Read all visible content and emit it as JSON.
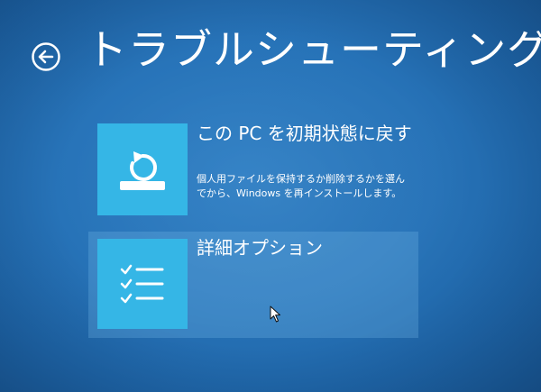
{
  "header": {
    "title": "トラブルシューティング",
    "back_icon": "back-arrow-circle-icon"
  },
  "options": [
    {
      "title": "この PC を初期状態に戻す",
      "description": "個人用ファイルを保持するか削除するかを選んでから、Windows を再インストールします。",
      "icon": "reset-pc-icon"
    },
    {
      "title": "詳細オプション",
      "icon": "checklist-icon",
      "selected": true
    }
  ],
  "colors": {
    "background": "#2773b8",
    "tile": "#35b6e6",
    "text": "#ffffff"
  }
}
